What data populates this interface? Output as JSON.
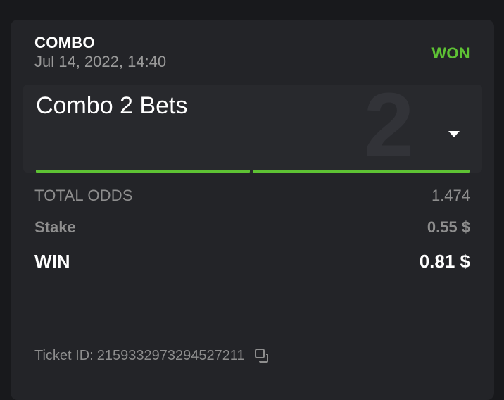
{
  "ticket": {
    "type": "COMBO",
    "date": "Jul 14, 2022, 14:40",
    "status": "WON",
    "status_color": "#5ec234",
    "combo": {
      "title": "Combo 2 Bets",
      "count": "2",
      "legs_settled": 2,
      "legs_total": 2
    },
    "total_odds_label": "TOTAL ODDS",
    "total_odds": "1.474",
    "stake_label": "Stake",
    "stake": "0.55 $",
    "win_label": "WIN",
    "win": "0.81 $",
    "ticket_id_label": "Ticket ID:",
    "ticket_id": "2159332973294527211",
    "copy_icon": "copy-icon"
  }
}
